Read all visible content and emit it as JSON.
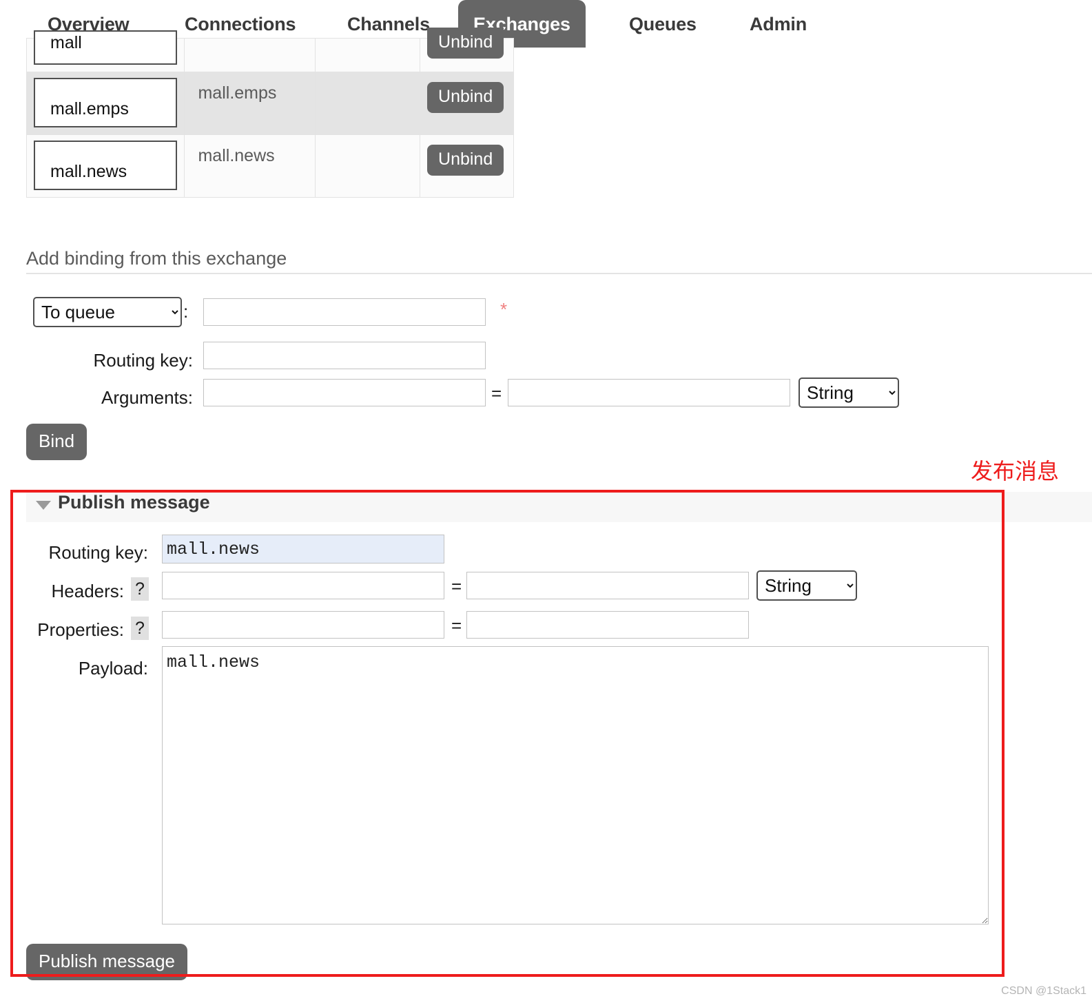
{
  "nav": {
    "items": [
      {
        "label": "Overview",
        "active": false
      },
      {
        "label": "Connections",
        "active": false
      },
      {
        "label": "Channels",
        "active": false
      },
      {
        "label": "Exchanges",
        "active": true
      },
      {
        "label": "Queues",
        "active": false
      },
      {
        "label": "Admin",
        "active": false
      }
    ]
  },
  "bindings": {
    "rows": [
      {
        "name": "mall",
        "routing_key": "",
        "arguments": "",
        "action": "Unbind"
      },
      {
        "name": "mall.emps",
        "routing_key": "mall.emps",
        "arguments": "",
        "action": "Unbind"
      },
      {
        "name": "mall.news",
        "routing_key": "mall.news",
        "arguments": "",
        "action": "Unbind"
      }
    ]
  },
  "add_binding": {
    "title": "Add binding from this exchange",
    "destination_select": "To queue",
    "destination_colon": ":",
    "destination_value": "",
    "required_marker": "*",
    "routing_key_label": "Routing key:",
    "routing_key_value": "",
    "arguments_label": "Arguments:",
    "arguments_key_value": "",
    "equals": "=",
    "arguments_val_value": "",
    "arguments_type": "String",
    "bind_button": "Bind"
  },
  "publish": {
    "annotation": "发布消息",
    "panel_title": "Publish message",
    "routing_key_label": "Routing key:",
    "routing_key_value": "mall.news",
    "headers_label": "Headers:",
    "headers_help": "?",
    "headers_key_value": "",
    "headers_equals": "=",
    "headers_val_value": "",
    "headers_type": "String",
    "properties_label": "Properties:",
    "properties_help": "?",
    "properties_key_value": "",
    "properties_equals": "=",
    "properties_val_value": "",
    "payload_label": "Payload:",
    "payload_value": "mall.news",
    "publish_button": "Publish message"
  },
  "watermark": "CSDN @1Stack1",
  "colors": {
    "accent_red": "#ee1c1c",
    "button_grey": "#666666",
    "input_highlight": "#e6edf9"
  }
}
